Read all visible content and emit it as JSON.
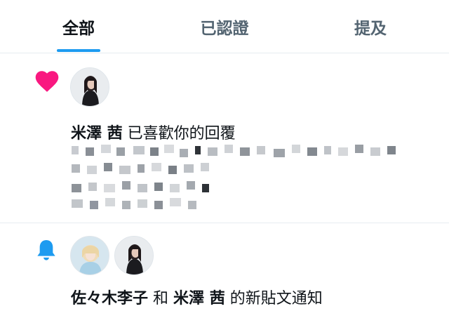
{
  "tabs": [
    {
      "label": "全部",
      "active": true
    },
    {
      "label": "已認證",
      "active": false
    },
    {
      "label": "提及",
      "active": false
    }
  ],
  "notifications": [
    {
      "icon": "heart-icon",
      "icon_color": "#f91880",
      "user": "米澤 茜",
      "action": "已喜歡你的回覆",
      "content_pixelated": true
    },
    {
      "icon": "bell-icon",
      "icon_color": "#1d9bf0",
      "user1": "佐々木李子",
      "conjunction": "和",
      "user2": "米澤 茜",
      "action": "的新貼文通知"
    }
  ],
  "colors": {
    "accent": "#1d9bf0",
    "like": "#f91880",
    "text": "#0f1419",
    "muted": "#536471"
  }
}
